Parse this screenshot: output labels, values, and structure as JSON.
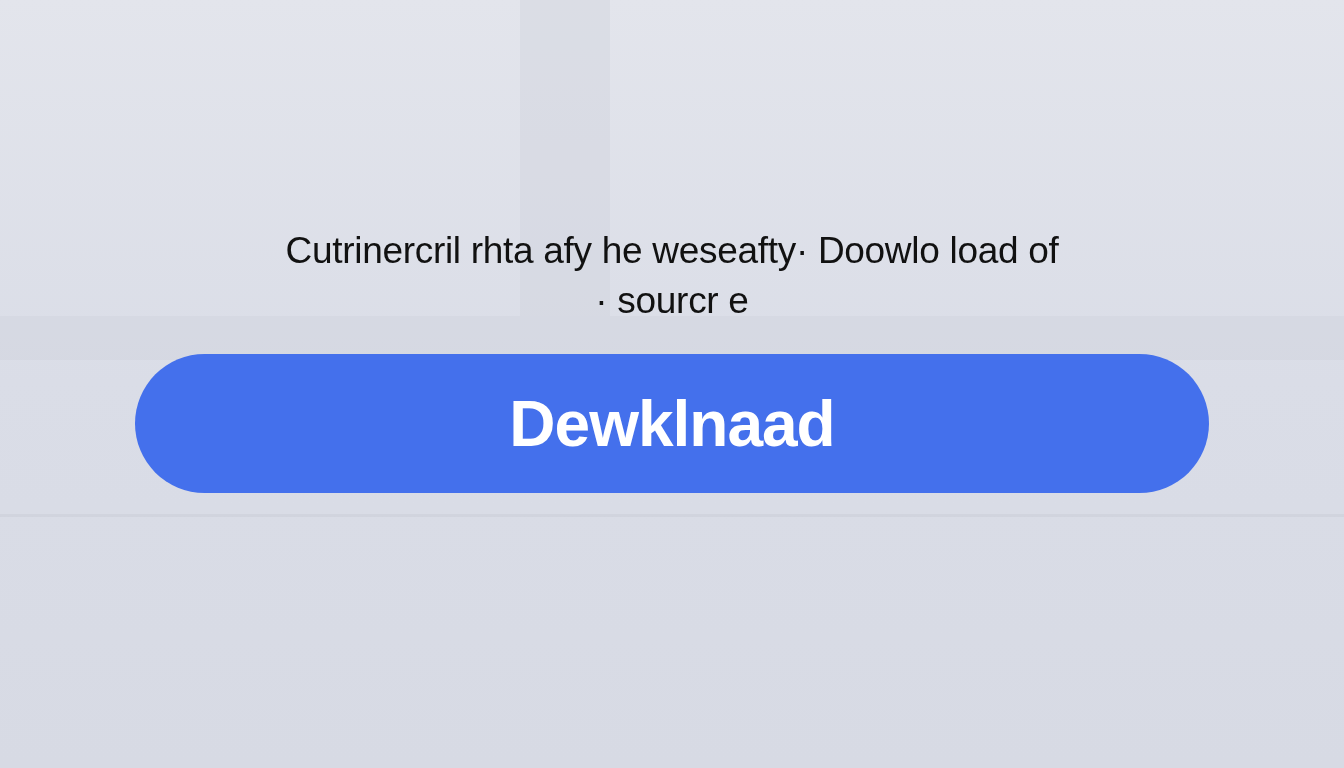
{
  "message": "Cutrinercril rhta afy  he weseafty·  Doowlo load of\n· sourcr e",
  "button": {
    "label": "Dewklnaad"
  }
}
